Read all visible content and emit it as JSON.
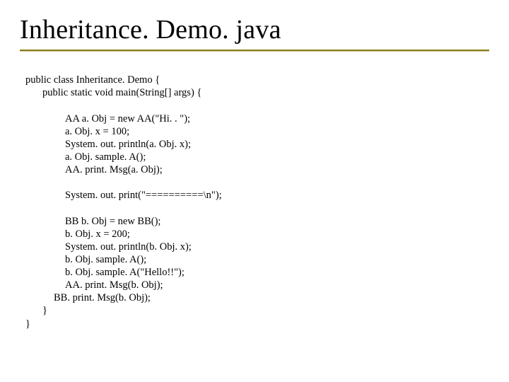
{
  "title": "Inheritance. Demo. java",
  "code": {
    "l01": "public class Inheritance. Demo {",
    "l02": "public static void main(String[] args) {",
    "l03": "AA a. Obj = new AA(\"Hi. . \");",
    "l04": "a. Obj. x = 100;",
    "l05": "System. out. println(a. Obj. x);",
    "l06": "a. Obj. sample. A();",
    "l07": "AA. print. Msg(a. Obj);",
    "l08": "System. out. print(\"==========\\n\");",
    "l09": "BB b. Obj = new BB();",
    "l10": "b. Obj. x = 200;",
    "l11": "System. out. println(b. Obj. x);",
    "l12": "b. Obj. sample. A();",
    "l13": "b. Obj. sample. A(\"Hello!!\");",
    "l14": "AA. print. Msg(b. Obj);",
    "l15": "BB. print. Msg(b. Obj);",
    "l16": "}",
    "l17": "}"
  }
}
